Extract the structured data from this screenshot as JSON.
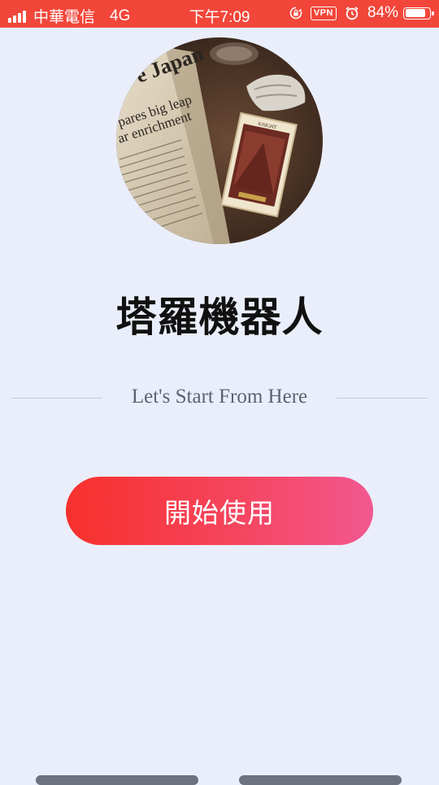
{
  "status_bar": {
    "carrier": "中華電信",
    "network": "4G",
    "time": "下午7:09",
    "vpn_label": "VPN",
    "battery_percent": "84%",
    "battery_level": 0.84,
    "icons": [
      "signal-icon",
      "rotation-lock-icon",
      "vpn-icon",
      "alarm-icon",
      "battery-icon"
    ]
  },
  "main": {
    "title": "塔羅機器人",
    "tagline": "Let's Start From Here",
    "start_button_label": "開始使用"
  },
  "colors": {
    "status_bar": "#F2463A",
    "background": "#EAEEFA",
    "button_gradient_start": "#F7302C",
    "button_gradient_end": "#F25890"
  }
}
